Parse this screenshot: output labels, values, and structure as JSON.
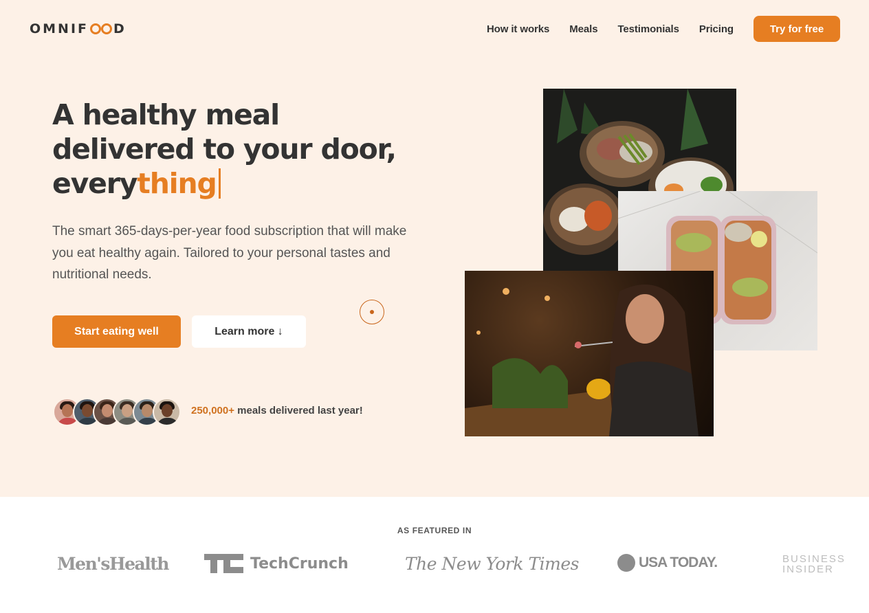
{
  "header": {
    "logo_text": "OMNIFOOD",
    "nav": [
      "How it works",
      "Meals",
      "Testimonials",
      "Pricing"
    ],
    "cta": "Try for free"
  },
  "hero": {
    "title_line1": "A healthy meal",
    "title_line2": "delivered to your door,",
    "title_line3_plain": "every",
    "title_line3_accent": "thing",
    "description": "The smart 365-days-per-year food subscription that will make you eat healthy again. Tailored to your personal tastes and nutritional needs.",
    "primary_button": "Start eating well",
    "secondary_button": "Learn more ↓",
    "delivered_count": "250,000+",
    "delivered_text": " meals delivered last year!"
  },
  "featured": {
    "title": "AS FEATURED IN",
    "logos": [
      "Men'sHealth",
      "TechCrunch",
      "The New York Times",
      "USA TODAY.",
      "BUSINESS INSIDER"
    ]
  },
  "colors": {
    "accent": "#e67e22",
    "hero_bg": "#fdf1e7",
    "text": "#333333"
  }
}
